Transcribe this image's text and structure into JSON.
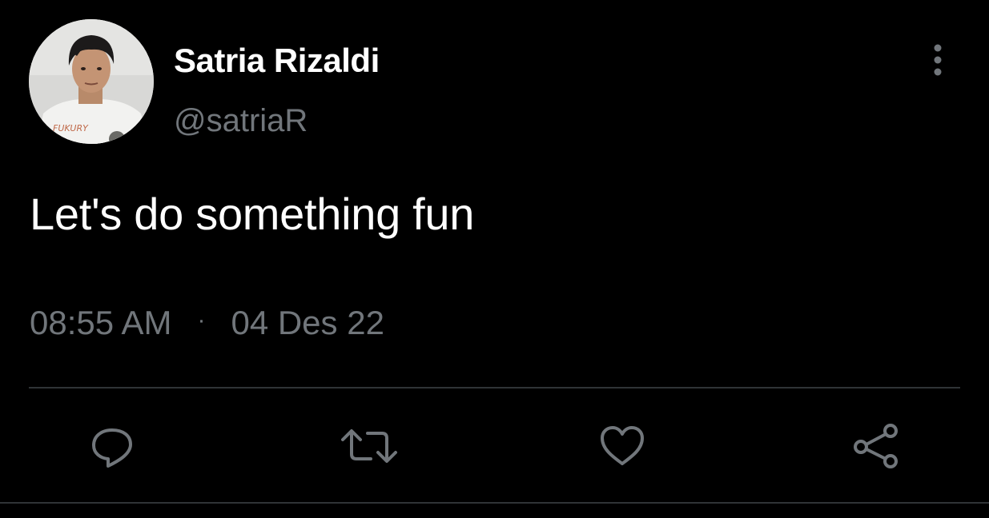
{
  "tweet": {
    "display_name": "Satria Rizaldi",
    "handle": "@satriaR",
    "text": "Let's do something fun",
    "time": "08:55 AM",
    "separator": "·",
    "date": "04 Des 22",
    "avatar_shirt_text": "FUKURY"
  },
  "actions": [
    {
      "name": "reply",
      "icon": "speech-bubble-icon"
    },
    {
      "name": "retweet",
      "icon": "retweet-arrows-icon"
    },
    {
      "name": "like",
      "icon": "heart-icon"
    },
    {
      "name": "share",
      "icon": "share-nodes-icon"
    }
  ],
  "colors": {
    "background": "#000000",
    "primary_text": "#ffffff",
    "secondary_text": "#71767b",
    "divider": "#2f3336"
  }
}
